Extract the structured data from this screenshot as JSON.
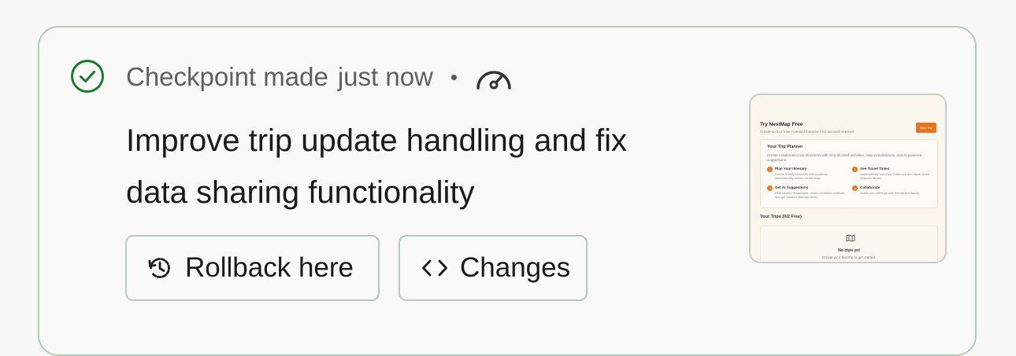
{
  "checkpoint": {
    "status_text": "Checkpoint made",
    "time_text": "just now",
    "separator": "•",
    "status_icon": "check-circle-icon",
    "speed_icon": "gauge-icon"
  },
  "description_line1": "Improve trip update handling and fix",
  "description_line2": "data sharing functionality",
  "buttons": {
    "rollback_label": "Rollback here",
    "rollback_icon": "history-icon",
    "changes_label": "Changes",
    "changes_icon": "code-icon"
  },
  "preview": {
    "title": "Try NestMap Free",
    "subtitle": "Create up to 2 trips • Limited features • No account required",
    "new_trip_button": "New Trip",
    "planner": {
      "title": "Your Trip Planner",
      "description": "Create collaborative trip itineraries with time-blocked activities, map visualizations, and AI-powered suggestions.",
      "items": [
        {
          "number": "1",
          "title": "Plan Your Itinerary",
          "desc": "Create a daily schedule with locations automatically pinned on the map."
        },
        {
          "number": "2",
          "title": "See Travel Times",
          "desc": "Automatically calculate distances and travel times between stops."
        },
        {
          "number": "3",
          "title": "Get AI Suggestions",
          "desc": "Find nearby restaurants, detect schedule conflicts, and get themed itinerary ideas."
        },
        {
          "number": "4",
          "title": "Collaborate",
          "desc": "Share and edit trips with friends and family."
        }
      ]
    },
    "your_trips_title": "Your Trips (0/2 Free)",
    "empty_title": "No trips yet",
    "empty_desc": "Create your first trip to get started."
  },
  "colors": {
    "accent_green": "#1a7a32",
    "border": "#b3cbbb",
    "preview_orange": "#e9721e"
  }
}
